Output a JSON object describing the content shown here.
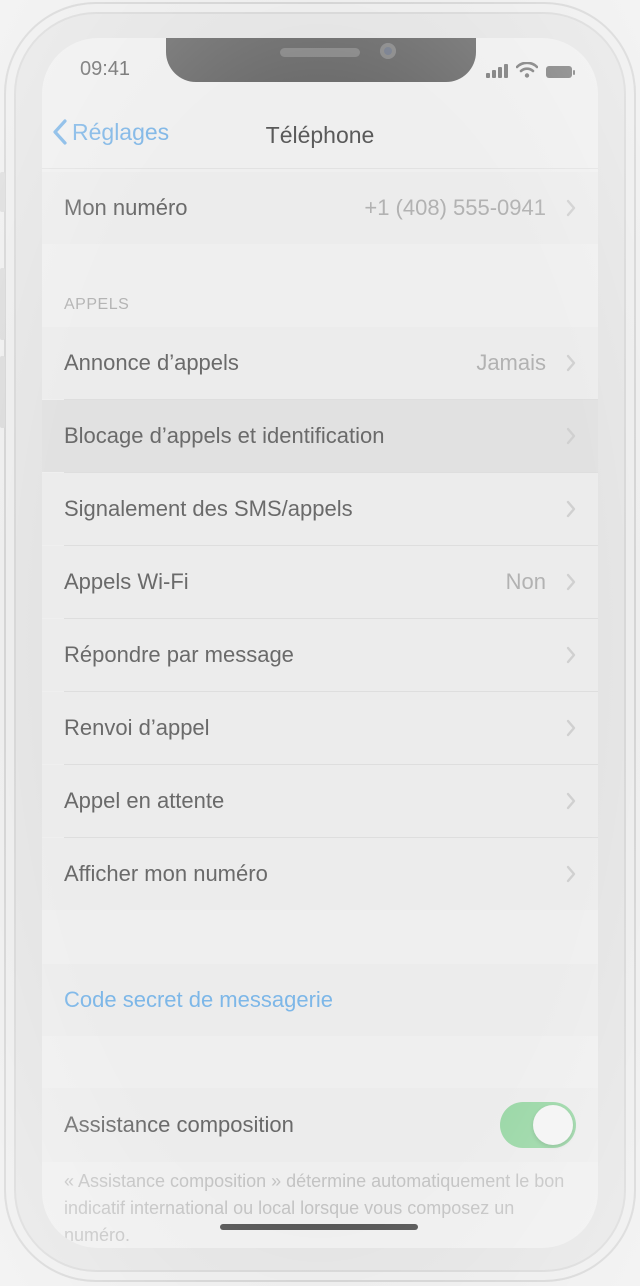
{
  "status_bar": {
    "time": "09:41"
  },
  "navbar": {
    "back_label": "Réglages",
    "title": "Téléphone"
  },
  "my_number": {
    "label": "Mon numéro",
    "value": "+1 (408) 555-0941"
  },
  "calls_section": {
    "header": "APPELS",
    "rows": [
      {
        "label": "Annonce d’appels",
        "value": "Jamais"
      },
      {
        "label": "Blocage d’appels et identification",
        "value": ""
      },
      {
        "label": "Signalement des SMS/appels",
        "value": ""
      },
      {
        "label": "Appels Wi-Fi",
        "value": "Non"
      },
      {
        "label": "Répondre par message",
        "value": ""
      },
      {
        "label": "Renvoi d’appel",
        "value": ""
      },
      {
        "label": "Appel en attente",
        "value": ""
      },
      {
        "label": "Afficher mon numéro",
        "value": ""
      }
    ]
  },
  "voicemail": {
    "label": "Code secret de messagerie"
  },
  "dial_assist": {
    "label": "Assistance composition",
    "enabled": true,
    "footnote": "« Assistance composition » détermine automatiquement le bon indicatif international ou local lorsque vous composez un numéro."
  },
  "colors": {
    "accent": "#7db7e8",
    "toggle_on": "#9ad7a6",
    "value_gray": "#b2b2b2"
  },
  "icons": {
    "back": "chevron-left-icon",
    "row": "chevron-right-icon",
    "wifi": "wifi-icon",
    "signal": "cellular-signal-icon",
    "battery": "battery-icon"
  }
}
